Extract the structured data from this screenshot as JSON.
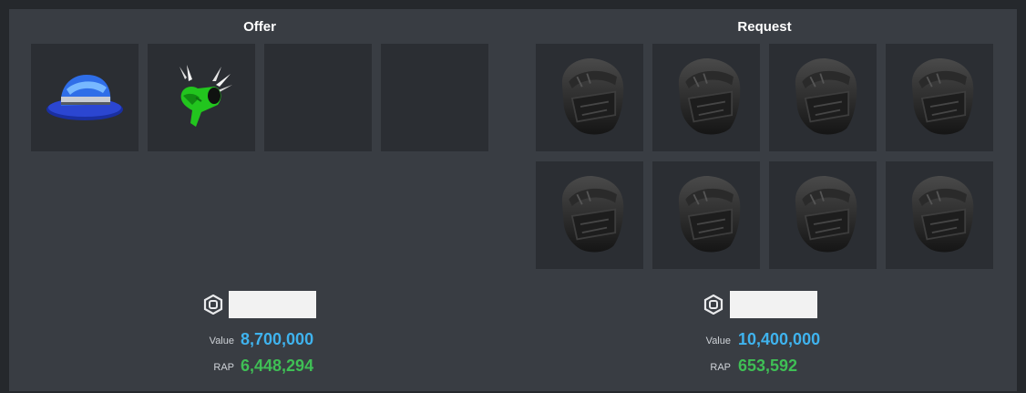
{
  "offer": {
    "title": "Offer",
    "items": [
      {
        "name": "blue-fedora",
        "icon": "blue-fedora-icon"
      },
      {
        "name": "green-winged-valk",
        "icon": "green-winged-hat-icon"
      },
      {
        "name": "empty",
        "icon": ""
      },
      {
        "name": "empty",
        "icon": ""
      }
    ],
    "value_label": "Value",
    "value": "8,700,000",
    "rap_label": "RAP",
    "rap": "6,448,294"
  },
  "request": {
    "title": "Request",
    "items": [
      {
        "icon": "black-helmet-icon"
      },
      {
        "icon": "black-helmet-icon"
      },
      {
        "icon": "black-helmet-icon"
      },
      {
        "icon": "black-helmet-icon"
      },
      {
        "icon": "black-helmet-icon"
      },
      {
        "icon": "black-helmet-icon"
      },
      {
        "icon": "black-helmet-icon"
      },
      {
        "icon": "black-helmet-icon"
      }
    ],
    "value_label": "Value",
    "value": "10,400,000",
    "rap_label": "RAP",
    "rap": "653,592"
  },
  "colors": {
    "value": "#3fb3ee",
    "rap": "#3fbf55",
    "panel": "#393d43",
    "slot": "#2b2e33"
  }
}
